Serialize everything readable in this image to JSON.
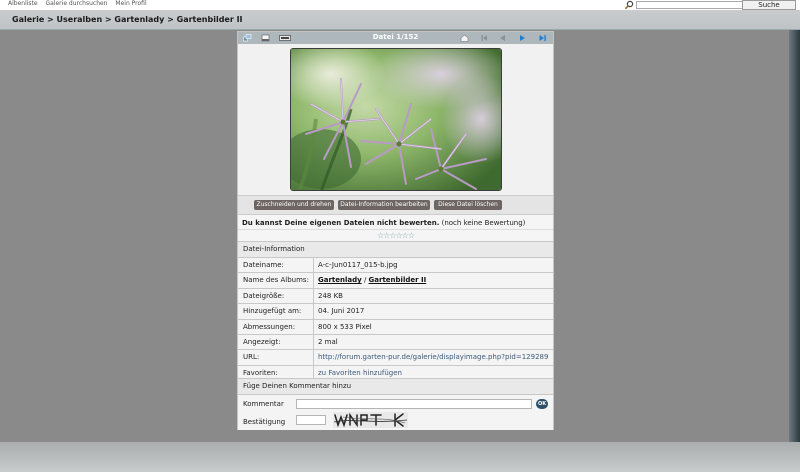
{
  "top_links": [
    "Albenliste",
    "Galerie durchsuchen",
    "Mein Profil"
  ],
  "search": {
    "button_label": "Suche",
    "placeholder": ""
  },
  "breadcrumb": "Galerie > Useralben > Gartenlady > Gartenbilder II",
  "nav": {
    "counter": "Datei 1/152"
  },
  "actions": {
    "crop_rotate": "Zuschneiden und drehen",
    "edit_info": "Datei-Information bearbeiten",
    "delete": "Diese Datei löschen"
  },
  "rating": {
    "notice_bold": "Du kannst Deine eigenen Dateien nicht bewerten.",
    "notice_rest": "(noch keine Bewertung)",
    "stars": "☆☆☆☆☆☆"
  },
  "info": {
    "title": "Datei-Information",
    "rows": [
      {
        "label": "Dateiname:",
        "value": "A-c-Jun0117_015-b.jpg"
      },
      {
        "label": "Name des Albums:",
        "value": "",
        "album_1": "Gartenlady",
        "album_sep": "/",
        "album_2": "Gartenbilder II"
      },
      {
        "label": "Dateigröße:",
        "value": "248 KB"
      },
      {
        "label": "Hinzugefügt am:",
        "value": "04. Juni 2017"
      },
      {
        "label": "Abmessungen:",
        "value": "800 x 533 Pixel"
      },
      {
        "label": "Angezeigt:",
        "value": "2 mal"
      },
      {
        "label": "URL:",
        "value": "http://forum.garten-pur.de/galerie/displayimage.php?pid=129289"
      },
      {
        "label": "Favoriten:",
        "value": "zu Favoriten hinzufügen"
      }
    ]
  },
  "comment": {
    "section_title": "Füge Deinen Kommentar hinzu",
    "comment_label": "Kommentar",
    "ok_label": "OK",
    "confirm_label": "Bestätigung",
    "captcha_text": "WNPTK"
  },
  "colors": {
    "accent_button": "#6c6563",
    "nav_bar": "#aeb7bc",
    "link": "#3a5a7a"
  }
}
